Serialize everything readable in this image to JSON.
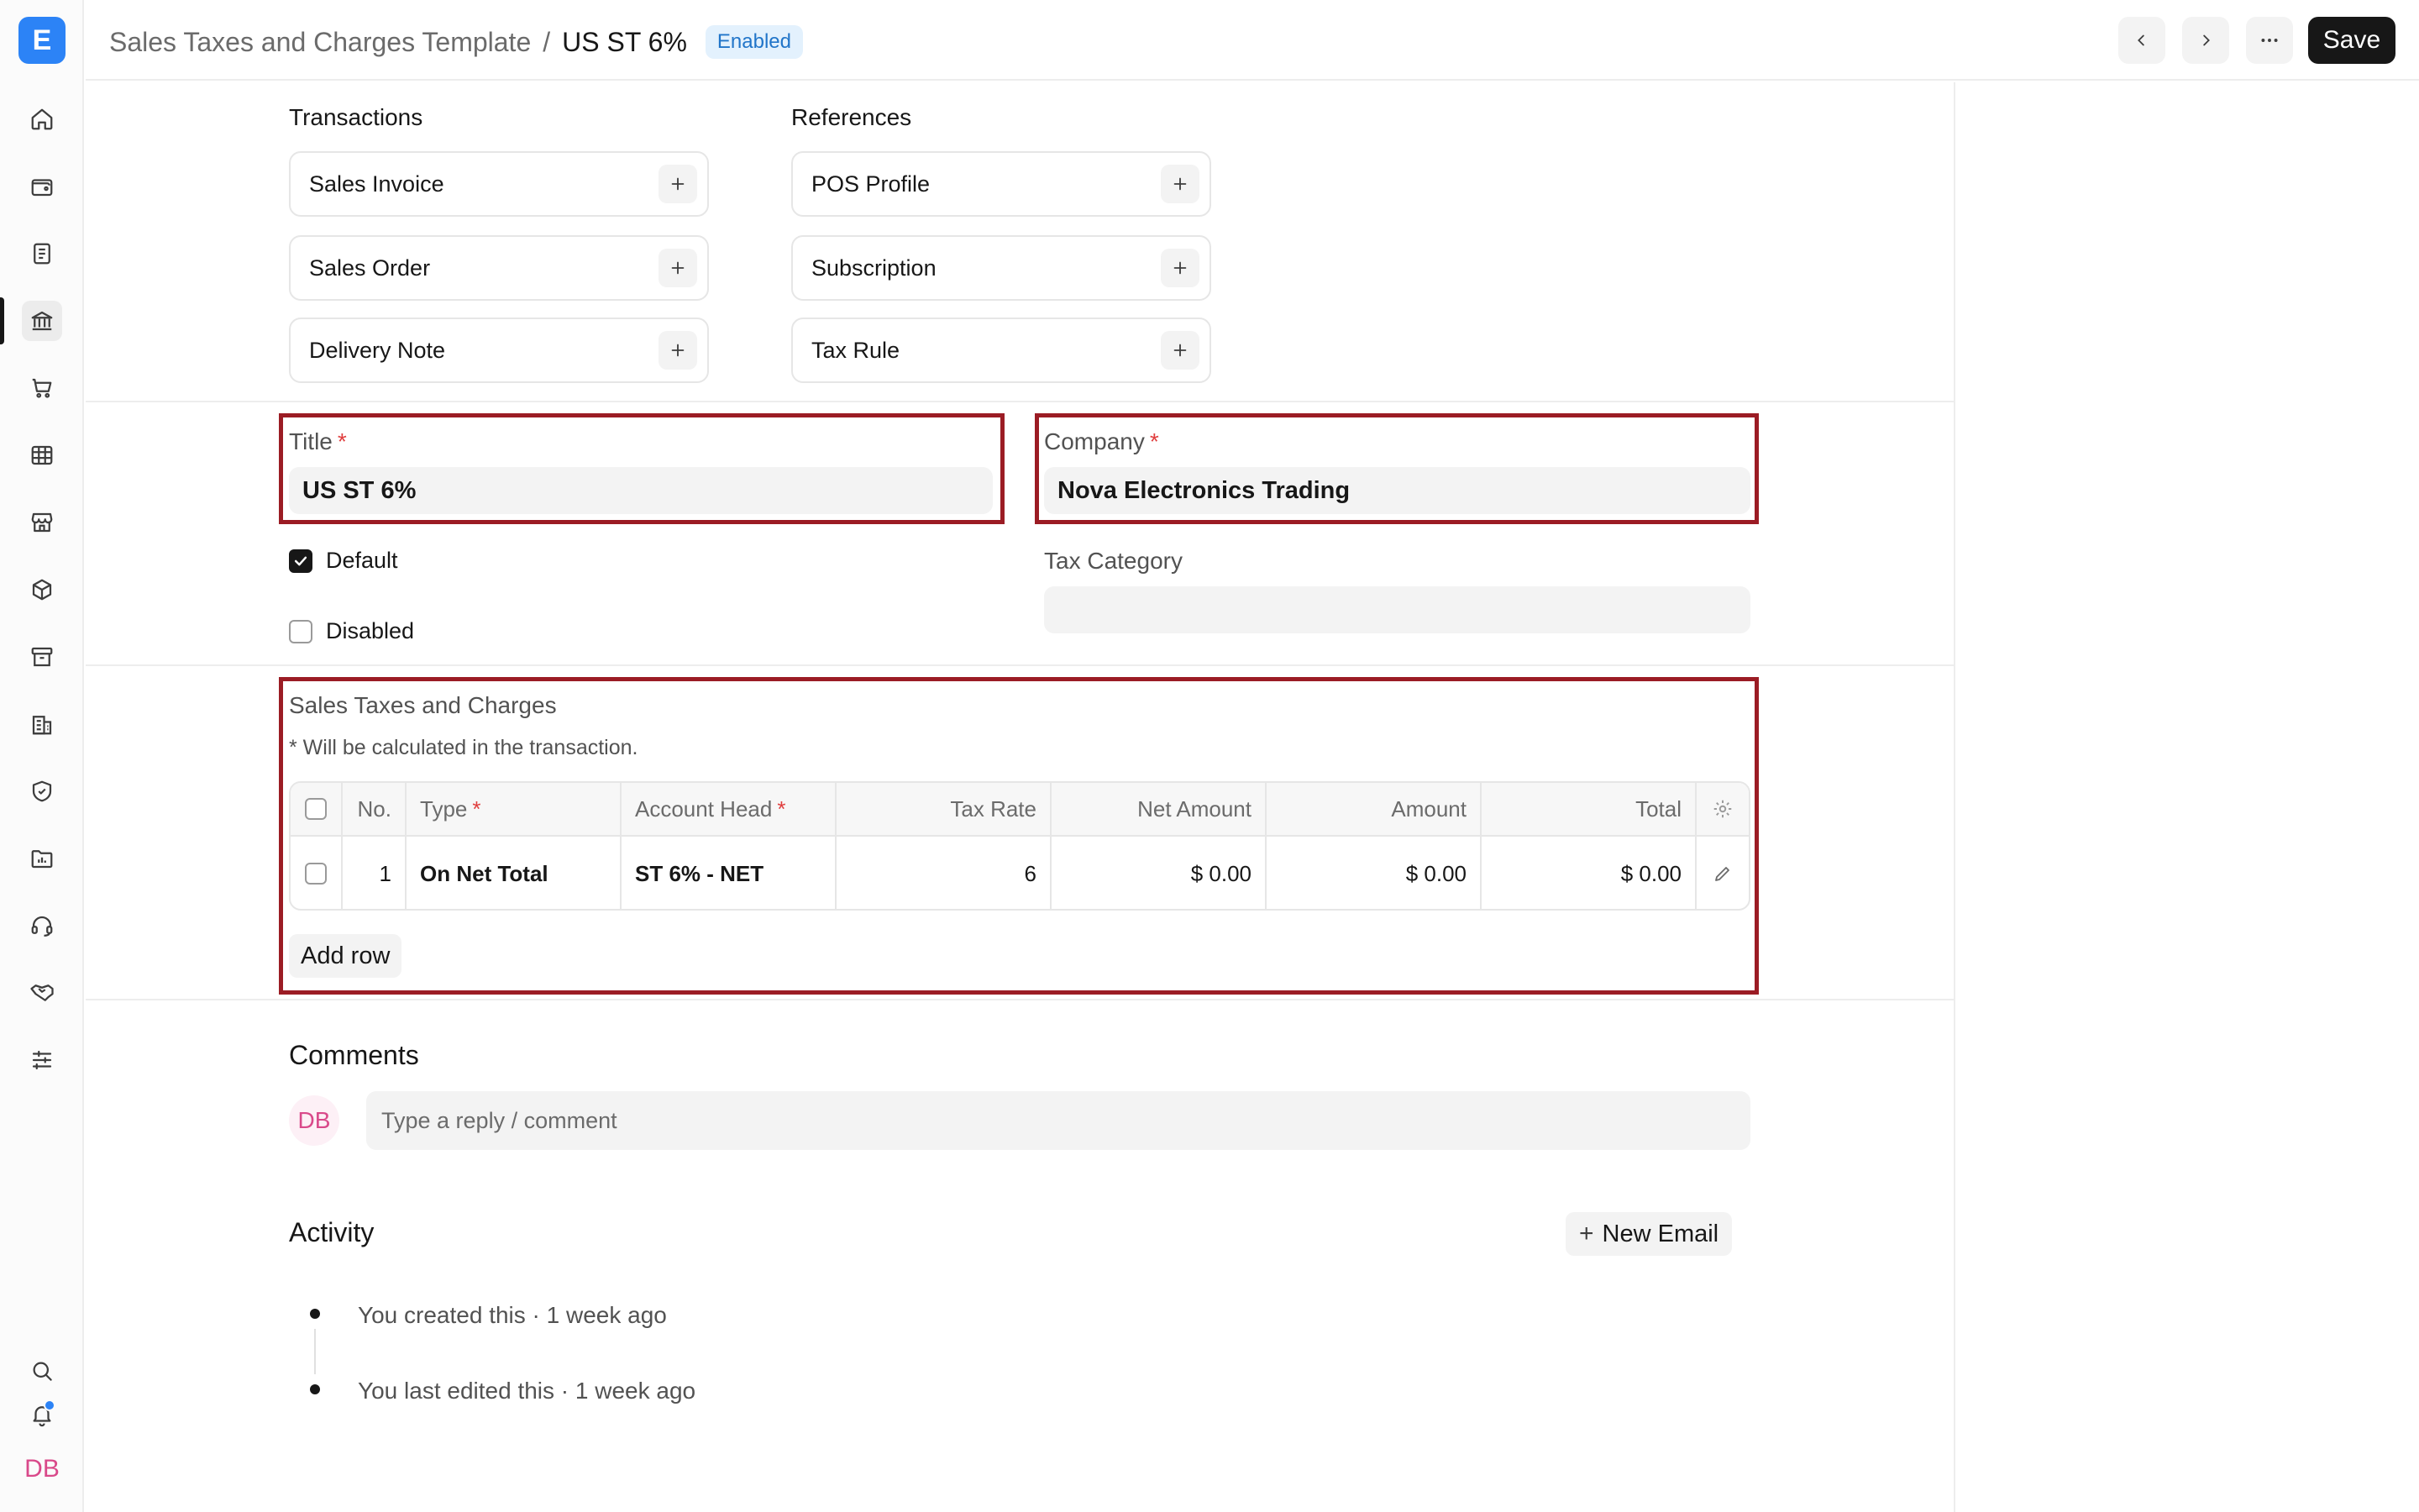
{
  "app": {
    "logo_letter": "E",
    "user_initials": "DB"
  },
  "sidebar": {
    "items": [
      {
        "icon": "home-icon"
      },
      {
        "icon": "wallet-icon"
      },
      {
        "icon": "document-icon"
      },
      {
        "icon": "bank-icon",
        "active": true
      },
      {
        "icon": "cart-icon"
      },
      {
        "icon": "table-icon"
      },
      {
        "icon": "store-icon"
      },
      {
        "icon": "cube-icon"
      },
      {
        "icon": "archive-icon"
      },
      {
        "icon": "building-icon"
      },
      {
        "icon": "shield-icon"
      },
      {
        "icon": "folder-chart-icon"
      },
      {
        "icon": "headset-icon"
      },
      {
        "icon": "handshake-icon"
      },
      {
        "icon": "sliders-icon"
      }
    ],
    "bottom": [
      {
        "icon": "search-icon"
      },
      {
        "icon": "bell-icon",
        "has_notification": true
      }
    ]
  },
  "header": {
    "parent": "Sales Taxes and Charges Template",
    "separator": "/",
    "current": "US ST 6%",
    "status_badge": "Enabled",
    "save_label": "Save"
  },
  "connections": {
    "transactions_title": "Transactions",
    "references_title": "References",
    "transactions": [
      "Sales Invoice",
      "Sales Order",
      "Delivery Note"
    ],
    "references": [
      "POS Profile",
      "Subscription",
      "Tax Rule"
    ]
  },
  "form": {
    "title_label": "Title",
    "title_value": "US ST 6%",
    "company_label": "Company",
    "company_value": "Nova Electronics Trading",
    "default_label": "Default",
    "default_checked": true,
    "disabled_label": "Disabled",
    "disabled_checked": false,
    "tax_category_label": "Tax Category",
    "tax_category_value": ""
  },
  "taxes": {
    "heading": "Sales Taxes and Charges",
    "note": "* Will be calculated in the transaction.",
    "columns": {
      "no": "No.",
      "type": "Type",
      "account_head": "Account Head",
      "tax_rate": "Tax Rate",
      "net_amount": "Net Amount",
      "amount": "Amount",
      "total": "Total"
    },
    "rows": [
      {
        "no": "1",
        "type": "On Net Total",
        "account_head": "ST 6% - NET",
        "tax_rate": "6",
        "net_amount": "$ 0.00",
        "amount": "$ 0.00",
        "total": "$ 0.00"
      }
    ],
    "add_row_label": "Add row"
  },
  "comments": {
    "heading": "Comments",
    "placeholder": "Type a reply / comment"
  },
  "activity": {
    "heading": "Activity",
    "new_email_label": "New Email",
    "items": [
      "You created this · 1 week ago",
      "You last edited this · 1 week ago"
    ]
  }
}
